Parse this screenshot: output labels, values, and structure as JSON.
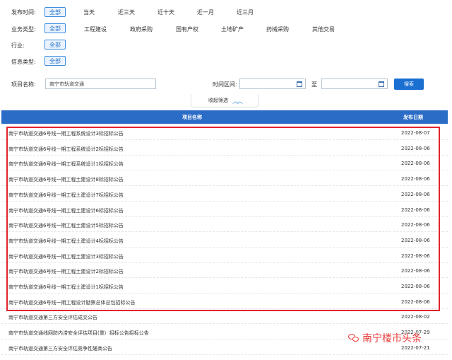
{
  "filters": {
    "publish_time": {
      "label": "发布时间:",
      "options": [
        "全部",
        "当天",
        "近三天",
        "近十天",
        "近一月",
        "近三月"
      ],
      "selected": "全部"
    },
    "business_type": {
      "label": "业务类型:",
      "options": [
        "全部",
        "工程建设",
        "政府采购",
        "国有产权",
        "土地矿产",
        "药械采购",
        "其他交易"
      ],
      "selected": "全部"
    },
    "industry": {
      "label": "行业:",
      "options": [
        "全部"
      ],
      "selected": "全部"
    },
    "info_type": {
      "label": "信息类型:",
      "options": [
        "全部"
      ],
      "selected": "全部"
    }
  },
  "search": {
    "project_name_label": "项目名称:",
    "project_name_value": "南宁市轨道交通",
    "time_range_label": "时间区间:",
    "to_label": "至",
    "start_date": "",
    "end_date": "",
    "search_button": "搜索"
  },
  "collapse": {
    "label": "收起筛选",
    "icon": "double-chevron-up-icon"
  },
  "table": {
    "headers": {
      "name": "项目名称",
      "date": "发布日期"
    },
    "rows": [
      {
        "name": "南宁市轨道交通6号线一期工程系统设计3标招标公告",
        "date": "2022-08-07"
      },
      {
        "name": "南宁市轨道交通6号线一期工程系统设计2标招标公告",
        "date": "2022-08-06"
      },
      {
        "name": "南宁市轨道交通6号线一期工程系统设计1标招标公告",
        "date": "2022-08-06"
      },
      {
        "name": "南宁市轨道交通6号线一期工程土建设计8标招标公告",
        "date": "2022-08-06"
      },
      {
        "name": "南宁市轨道交通6号线一期工程土建设计7标招标公告",
        "date": "2022-08-06"
      },
      {
        "name": "南宁市轨道交通6号线一期工程土建设计6标招标公告",
        "date": "2022-08-06"
      },
      {
        "name": "南宁市轨道交通6号线一期工程土建设计5标招标公告",
        "date": "2022-08-06"
      },
      {
        "name": "南宁市轨道交通6号线一期工程土建设计4标招标公告",
        "date": "2022-08-06"
      },
      {
        "name": "南宁市轨道交通6号线一期工程土建设计3标招标公告",
        "date": "2022-08-06"
      },
      {
        "name": "南宁市轨道交通6号线一期工程土建设计2标招标公告",
        "date": "2022-08-06"
      },
      {
        "name": "南宁市轨道交通6号线一期工程土建设计1标招标公告",
        "date": "2022-08-06"
      },
      {
        "name": "南宁市轨道交通6号线一期工程设计勘察总体总包招标公告",
        "date": "2022-08-06"
      },
      {
        "name": "南宁市轨道交通第三方安全评估成交公告",
        "date": "2022-08-02"
      },
      {
        "name": "南宁市轨道交通线网防内涝安全评估项目(重）招标公告招标公告",
        "date": "2022-07-29"
      },
      {
        "name": "南宁市轨道交通第三方安全评估竞争性磋商公告",
        "date": "2022-07-21"
      }
    ]
  },
  "watermark": {
    "text": "南宁楼市头条"
  },
  "colors": {
    "accent": "#1a6fd1",
    "header_bg": "#2b6cc6",
    "highlight": "#e0242c"
  }
}
